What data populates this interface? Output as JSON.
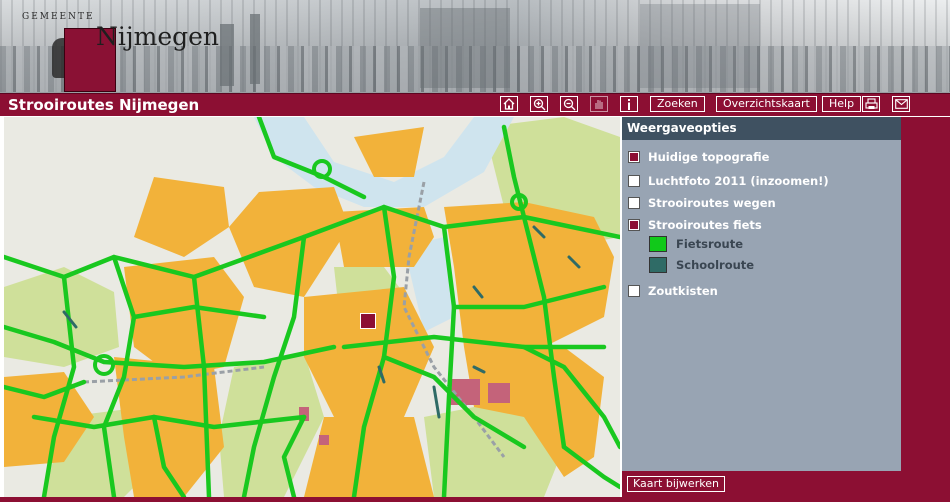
{
  "header": {
    "logo_small": "GEMEENTE",
    "logo_name": "Nijmegen"
  },
  "titlebar": {
    "title": "Strooiroutes Nijmegen",
    "icons": [
      "home-icon",
      "zoom-in-icon",
      "zoom-out-icon",
      "pan-hand-icon",
      "info-icon"
    ],
    "buttons": {
      "search": "Zoeken",
      "overview": "Overzichtskaart",
      "help": "Help"
    },
    "icons_right": [
      "print-icon",
      "mail-icon"
    ]
  },
  "panel": {
    "header": "Weergaveopties",
    "options": [
      {
        "label": "Huidige topografie",
        "checked": true
      },
      {
        "label": "Luchtfoto 2011 (inzoomen!)",
        "checked": false
      },
      {
        "label": "Strooiroutes wegen",
        "checked": false
      },
      {
        "label": "Strooiroutes fiets",
        "checked": true
      },
      {
        "label": "Zoutkisten",
        "checked": false
      }
    ],
    "legend": [
      {
        "label": "Fietsroute",
        "color": "#11c91a"
      },
      {
        "label": "Schoolroute",
        "color": "#2f6b66"
      }
    ],
    "update_button": "Kaart bijwerken"
  },
  "colors": {
    "brand": "#8c0f33",
    "panel_bg": "#98a4b3",
    "panel_header": "#3f5161",
    "route_green": "#19c81f",
    "urban": "#f2b23a",
    "park": "#cfe09a",
    "water": "#cfe4ee"
  }
}
